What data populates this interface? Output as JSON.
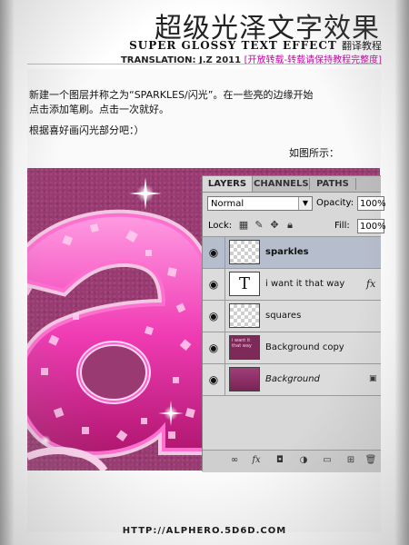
{
  "header": {
    "title_cn": "超级光泽文字效果",
    "title_en": "SUPER GLOSSY TEXT EFFECT",
    "title_en_suffix": "翻译教程",
    "credit": "TRANSLATION: J.Z  2011",
    "notice": "[开放转载-转载请保持教程完整度]"
  },
  "body": {
    "line1": "新建一个图层并称之为“SPARKLES/闪光”。在一些亮的边缘开始",
    "line2": "点击添加笔刷。点击一次就好。",
    "line3": "根据喜好画闪光部分吧：）",
    "caption": "如图所示："
  },
  "layers_panel": {
    "tabs": [
      "LAYERS",
      "CHANNELS",
      "PATHS"
    ],
    "blend_mode": "Normal",
    "opacity_label": "Opacity:",
    "opacity_value": "100%",
    "lock_label": "Lock:",
    "fill_label": "Fill:",
    "fill_value": "100%",
    "layers": [
      {
        "name": "sparkles",
        "thumb": "checker",
        "selected": true
      },
      {
        "name": "i want it that way",
        "thumb": "text",
        "thumb_glyph": "T",
        "fx": "fx"
      },
      {
        "name": "squares",
        "thumb": "checker"
      },
      {
        "name": "Background copy",
        "thumb": "bgcopy",
        "thumb_text": "i want it that way"
      },
      {
        "name": "Background",
        "thumb": "bg",
        "locked": true
      }
    ],
    "bottom_icons": [
      "link-icon",
      "fx-icon",
      "mask-icon",
      "adjustment-icon",
      "folder-icon",
      "new-layer-icon",
      "trash-icon"
    ]
  },
  "colors": {
    "canvas_bg": "#9a3a72",
    "accent_pink": "#ff4fc8",
    "notice": "#cc00aa"
  },
  "footer": {
    "url": "HTTP://ALPHERO.5D6D.COM"
  }
}
